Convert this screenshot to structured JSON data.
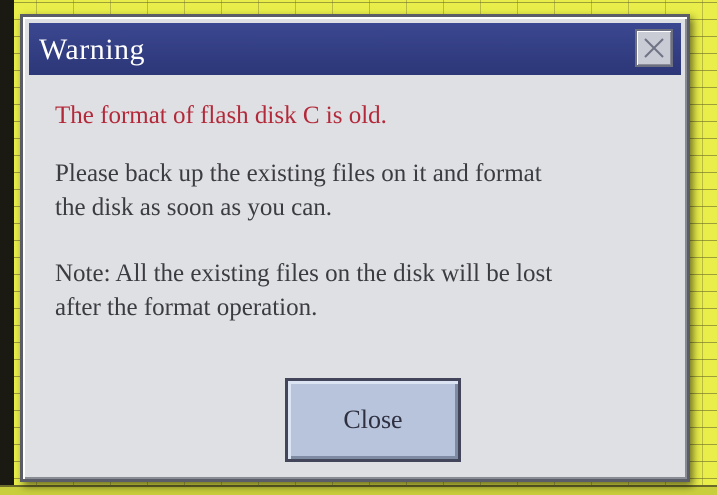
{
  "dialog": {
    "title": "Warning",
    "close_icon": "close-icon",
    "message_warning": "The format of flash disk C is old.",
    "message_body_line1": "Please back up the existing files on it and format",
    "message_body_line2": "the disk as soon as you can.",
    "note_line1": "Note: All the existing files on the disk will be lost",
    "note_line2": "after the format operation.",
    "close_button_label": "Close"
  },
  "colors": {
    "titlebar": "#2c3778",
    "warning_text": "#b3293a",
    "dialog_bg": "#dfe0e3",
    "button_bg": "#b7c4dc",
    "background_grid": "#e9ee4a"
  }
}
